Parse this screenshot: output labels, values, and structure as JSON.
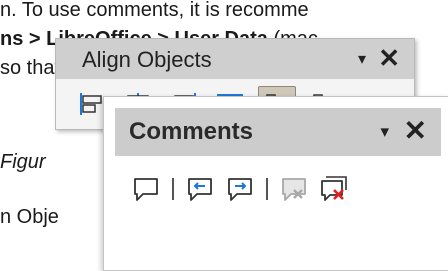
{
  "document": {
    "line1": "n. To use comments, it is recomme",
    "line2_bold": "ns > LibreOffice > User Data",
    "line2_rest": " (mac",
    "line3": "so that comments can be easily ide",
    "line4": "Figur",
    "line5": "n Obje"
  },
  "align_toolbar": {
    "title": "Align Objects",
    "menu_glyph": "▾",
    "close_glyph": "✕",
    "buttons": [
      {
        "name": "align-left"
      },
      {
        "name": "align-center"
      },
      {
        "name": "align-right"
      },
      {
        "name": "align-top"
      },
      {
        "name": "align-middle",
        "selected": true
      },
      {
        "name": "align-bottom"
      }
    ]
  },
  "comments_toolbar": {
    "title": "Comments",
    "menu_glyph": "▾",
    "close_glyph": "✕",
    "buttons": [
      {
        "name": "insert-comment",
        "enabled": true
      },
      {
        "name": "previous-comment",
        "enabled": true
      },
      {
        "name": "next-comment",
        "enabled": true
      },
      {
        "name": "delete-comment",
        "enabled": false
      },
      {
        "name": "delete-all-comments",
        "enabled": true
      }
    ]
  },
  "colors": {
    "accent_blue": "#1e78d6",
    "delete_red": "#e02020",
    "title_bar": "#cccccc",
    "selected_bg": "#cfc7b8"
  }
}
